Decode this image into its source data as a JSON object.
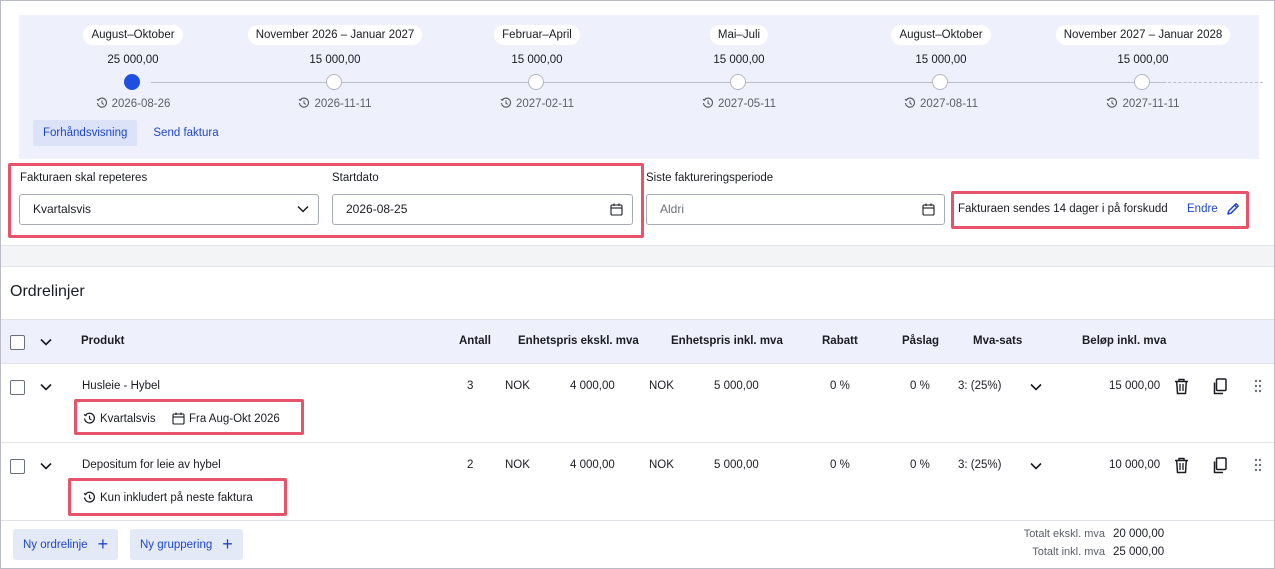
{
  "timeline": {
    "periods": [
      {
        "label": "August–Oktober",
        "amount": "25 000,00",
        "date": "2026-08-26",
        "active": true
      },
      {
        "label": "November 2026 – Januar 2027",
        "amount": "15 000,00",
        "date": "2026-11-11",
        "active": false
      },
      {
        "label": "Februar–April",
        "amount": "15 000,00",
        "date": "2027-02-11",
        "active": false
      },
      {
        "label": "Mai–Juli",
        "amount": "15 000,00",
        "date": "2027-05-11",
        "active": false
      },
      {
        "label": "August–Oktober",
        "amount": "15 000,00",
        "date": "2027-08-11",
        "active": false
      },
      {
        "label": "November 2027 – Januar 2028",
        "amount": "15 000,00",
        "date": "2027-11-11",
        "active": false
      }
    ],
    "preview_label": "Forhåndsvisning",
    "send_label": "Send faktura"
  },
  "settings": {
    "repeat_label": "Fakturaen skal repeteres",
    "repeat_value": "Kvartalsvis",
    "start_label": "Startdato",
    "start_value": "2026-08-25",
    "last_label": "Siste faktureringsperiode",
    "last_placeholder": "Aldri",
    "advance_text": "Fakturaen sendes 14 dager i på forskudd",
    "edit_label": "Endre"
  },
  "orderlines": {
    "title": "Ordrelinjer",
    "columns": {
      "product": "Produkt",
      "qty": "Antall",
      "unit_ex": "Enhetspris ekskl. mva",
      "unit_inc": "Enhetspris inkl. mva",
      "discount": "Rabatt",
      "markup": "Påslag",
      "vat": "Mva-sats",
      "total": "Beløp inkl. mva"
    },
    "rows": [
      {
        "product": "Husleie - Hybel",
        "qty": "3",
        "cur1": "NOK",
        "unit_ex": "4 000,00",
        "cur2": "NOK",
        "unit_inc": "5 000,00",
        "discount": "0 %",
        "markup": "0 %",
        "vat": "3: (25%)",
        "total": "15 000,00",
        "tag_repeat": "Kvartalsvis",
        "tag_period": "Fra Aug-Okt 2026"
      },
      {
        "product": "Depositum for leie av hybel",
        "qty": "2",
        "cur1": "NOK",
        "unit_ex": "4 000,00",
        "cur2": "NOK",
        "unit_inc": "5 000,00",
        "discount": "0 %",
        "markup": "0 %",
        "vat": "3: (25%)",
        "total": "10 000,00",
        "tag_once": "Kun inkludert på neste faktura"
      }
    ]
  },
  "footer": {
    "new_line": "Ny ordrelinje",
    "new_group": "Ny gruppering",
    "total_ex_label": "Totalt ekskl. mva",
    "total_ex_value": "20 000,00",
    "total_inc_label": "Totalt inkl. mva",
    "total_inc_value": "25 000,00"
  }
}
